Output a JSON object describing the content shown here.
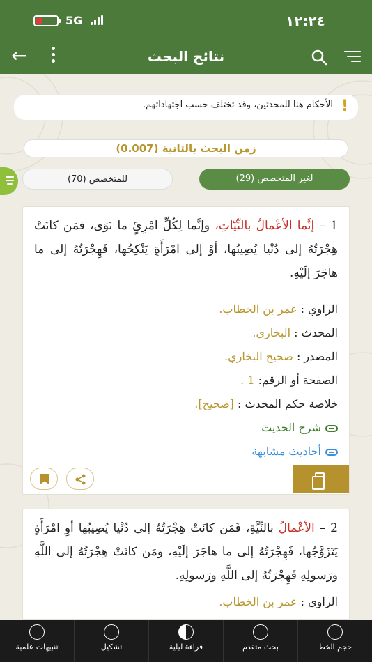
{
  "status": {
    "time": "١٢:٢٤",
    "network": "5G"
  },
  "header": {
    "title": "نتائج البحث"
  },
  "notice": {
    "text": "الأحكام هنا للمحدثين، وقد تختلف حسب اجتهاداتهم."
  },
  "search_time": "زمن البحث بالثانية (0.007)",
  "tabs": {
    "nonspecialist": "لغير المتخصص (29)",
    "specialist": "للمتخصص (70)"
  },
  "results": [
    {
      "num": "1 –",
      "red": "إنَّما الأعْمالُ بالنِّيّاتِ،",
      "text": "وإنَّما لِكُلِّ امْرِئٍ ما نَوَى، فمَن كانَتْ هِجْرَتُهُ إلى دُنْيا يُصِيبُها، أوْ إلى امْرَأَةٍ يَنْكِحُها، فَهِجْرَتُهُ إلى ما هاجَرَ إلَيْهِ.",
      "narrator_label": "الراوي :",
      "narrator": "عمر بن الخطاب.",
      "muhaddith_label": "المحدث :",
      "muhaddith": "البخاري.",
      "source_label": "المصدر :",
      "source": "صحيح البخاري.",
      "page_label": "الصفحة أو الرقم:",
      "page": "1 .",
      "verdict_label": "خلاصة حكم المحدث :",
      "verdict": "[صحيح].",
      "explain_link": "شرح الحديث",
      "similar_link": "أحاديث مشابهة"
    },
    {
      "num": "2 –",
      "red": "الأعْمالُ",
      "text": "بالنِّيَّةِ، فَمَن كانَتْ هِجْرَتُهُ إلى دُنْيا يُصِيبُها أوِ امْرَأَةٍ يَتَزَوَّجُها، فَهِجْرَتُهُ إلى ما هاجَرَ إلَيْهِ، ومَن كانَتْ هِجْرَتُهُ إلى اللَّهِ ورَسولِهِ فَهِجْرَتُهُ إلى اللَّهِ ورَسولِهِ.",
      "narrator_label": "الراوي :",
      "narrator": "عمر بن الخطاب."
    }
  ],
  "bottom_bar": [
    {
      "label": "حجم الخط",
      "icon": "font-size-icon"
    },
    {
      "label": "بحث متقدم",
      "icon": "advanced-search-icon"
    },
    {
      "label": "قراءة ليلية",
      "icon": "night-mode-icon"
    },
    {
      "label": "تشكيل",
      "icon": "diacritics-icon"
    },
    {
      "label": "تنبيهات علمية",
      "icon": "notifications-icon"
    }
  ],
  "colors": {
    "primary": "#4b7a3a",
    "gold": "#b8962e",
    "red": "#c62f27",
    "link_green": "#3f7d2b",
    "link_blue": "#3a8fd9"
  }
}
